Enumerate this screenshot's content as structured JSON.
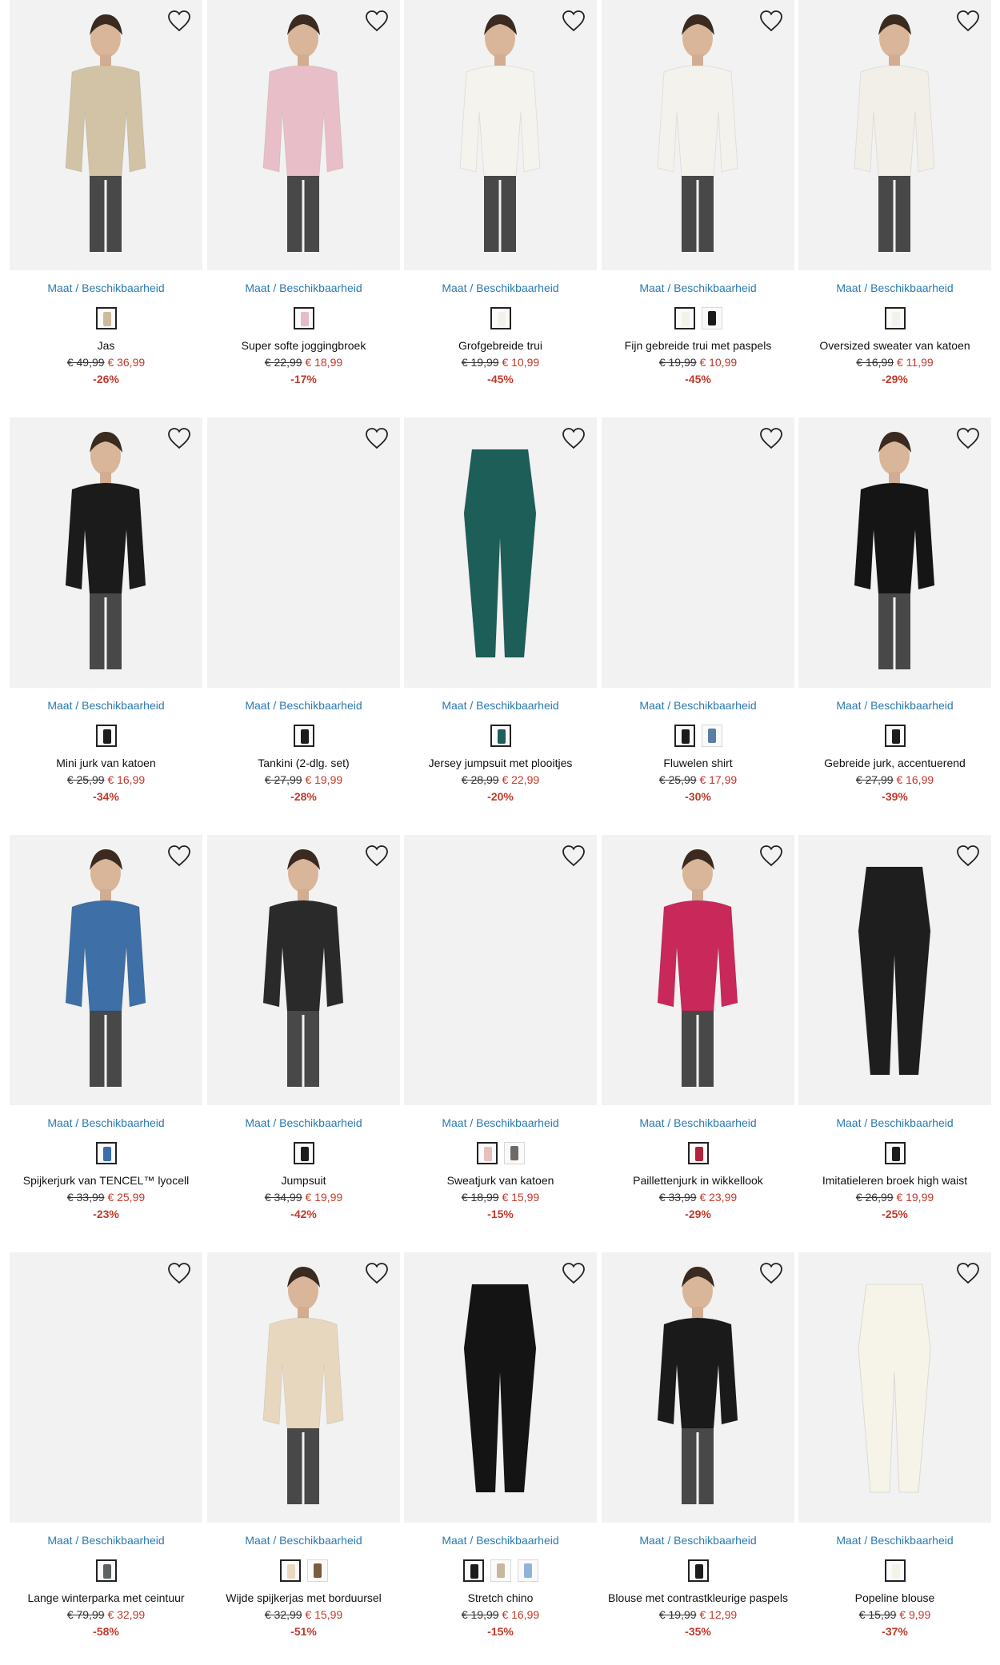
{
  "labels": {
    "availability": "Maat / Beschikbaarheid"
  },
  "colors": {
    "link": "#2a7ab0",
    "sale": "#c0392b",
    "image_bg": "#f2f2f2"
  },
  "products": [
    {
      "name": "Jas",
      "old": "€ 49,99",
      "new": "€ 36,99",
      "disc": "-26%",
      "swatches": [
        "#cdbb9c"
      ],
      "garment": "#d2c3a6",
      "model": true
    },
    {
      "name": "Super softe joggingbroek",
      "old": "€ 22,99",
      "new": "€ 18,99",
      "disc": "-17%",
      "swatches": [
        "#e6bcc6"
      ],
      "garment": "#e8bfc8",
      "model": true
    },
    {
      "name": "Grofgebreide trui",
      "old": "€ 19,99",
      "new": "€ 10,99",
      "disc": "-45%",
      "swatches": [
        "#f4f1ea"
      ],
      "garment": "#f5f3ee",
      "model": true
    },
    {
      "name": "Fijn gebreide trui met paspels",
      "old": "€ 19,99",
      "new": "€ 10,99",
      "disc": "-45%",
      "swatches": [
        "#f4f1ea",
        "#1a1a1a"
      ],
      "garment": "#f4f2ec",
      "model": true
    },
    {
      "name": "Oversized sweater van katoen",
      "old": "€ 16,99",
      "new": "€ 11,99",
      "disc": "-29%",
      "swatches": [
        "#f4f1ea"
      ],
      "garment": "#f2efe8",
      "model": true
    },
    {
      "name": "Mini jurk van katoen",
      "old": "€ 25,99",
      "new": "€ 16,99",
      "disc": "-34%",
      "swatches": [
        "#1c1c1c"
      ],
      "garment": "#1b1b1b",
      "model": true
    },
    {
      "name": "Tankini (2-dlg. set)",
      "old": "€ 27,99",
      "new": "€ 19,99",
      "disc": "-28%",
      "swatches": [
        "#1c1c1c"
      ],
      "garment": "",
      "model": false
    },
    {
      "name": "Jersey jumpsuit met plooitjes",
      "old": "€ 28,99",
      "new": "€ 22,99",
      "disc": "-20%",
      "swatches": [
        "#1f5f5a"
      ],
      "garment": "#1e5e59",
      "model": false
    },
    {
      "name": "Fluwelen shirt",
      "old": "€ 25,99",
      "new": "€ 17,99",
      "disc": "-30%",
      "swatches": [
        "#1c1c1c",
        "#5a7fa5"
      ],
      "garment": "",
      "model": false
    },
    {
      "name": "Gebreide jurk, accentuerend",
      "old": "€ 27,99",
      "new": "€ 16,99",
      "disc": "-39%",
      "swatches": [
        "#1c1c1c"
      ],
      "garment": "#151515",
      "model": true
    },
    {
      "name": "Spijkerjurk van TENCEL™ lyocell",
      "old": "€ 33,99",
      "new": "€ 25,99",
      "disc": "-23%",
      "swatches": [
        "#3b6ea8"
      ],
      "garment": "#3e6fa6",
      "model": true
    },
    {
      "name": "Jumpsuit",
      "old": "€ 34,99",
      "new": "€ 19,99",
      "disc": "-42%",
      "swatches": [
        "#1c1c1c"
      ],
      "garment": "#2a2a2a",
      "model": true
    },
    {
      "name": "Sweatjurk van katoen",
      "old": "€ 18,99",
      "new": "€ 15,99",
      "disc": "-15%",
      "swatches": [
        "#e6c0bd",
        "#6f6a66"
      ],
      "garment": "",
      "model": false
    },
    {
      "name": "Paillettenjurk in wikkellook",
      "old": "€ 33,99",
      "new": "€ 23,99",
      "disc": "-29%",
      "swatches": [
        "#b0243a"
      ],
      "garment": "#c8285a",
      "model": true
    },
    {
      "name": "Imitatieleren broek high waist",
      "old": "€ 26,99",
      "new": "€ 19,99",
      "disc": "-25%",
      "swatches": [
        "#1c1c1c"
      ],
      "garment": "#1e1e1e",
      "model": false
    },
    {
      "name": "Lange winterparka met ceintuur",
      "old": "€ 79,99",
      "new": "€ 32,99",
      "disc": "-58%",
      "swatches": [
        "#5d6360"
      ],
      "garment": "",
      "model": false
    },
    {
      "name": "Wijde spijkerjas met borduursel",
      "old": "€ 32,99",
      "new": "€ 15,99",
      "disc": "-51%",
      "swatches": [
        "#e9d9c2",
        "#7a5c3e"
      ],
      "garment": "#e8d7bf",
      "model": true
    },
    {
      "name": "Stretch chino",
      "old": "€ 19,99",
      "new": "€ 16,99",
      "disc": "-15%",
      "swatches": [
        "#1c1c1c",
        "#c9b79c",
        "#8fb3d9"
      ],
      "garment": "#141414",
      "model": false
    },
    {
      "name": "Blouse met contrastkleurige paspels",
      "old": "€ 19,99",
      "new": "€ 12,99",
      "disc": "-35%",
      "swatches": [
        "#1c1c1c"
      ],
      "garment": "#1a1a1a",
      "model": true
    },
    {
      "name": "Popeline blouse",
      "old": "€ 15,99",
      "new": "€ 9,99",
      "disc": "-37%",
      "swatches": [
        "#f5f3e6"
      ],
      "garment": "#f6f4e8",
      "model": false
    }
  ]
}
